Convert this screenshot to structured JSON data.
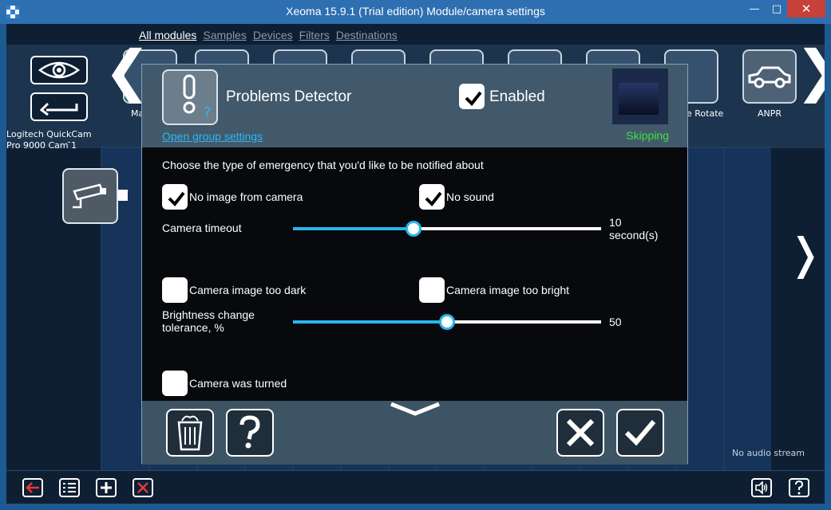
{
  "window": {
    "title": "Xeoma 15.9.1 (Trial edition) Module/camera settings",
    "min_glyph": "—",
    "max_glyph": "□",
    "close_glyph": "✕"
  },
  "nav": {
    "tabs": [
      "All modules",
      "Samples",
      "Devices",
      "Filters",
      "Destinations"
    ]
  },
  "modules_strip": {
    "left_arrow": "❮",
    "right_arrow": "❯",
    "partial_label": "Ma",
    "rotate_label": "e Rotate",
    "anpr_label": "ANPR"
  },
  "camera": {
    "name": "Logitech QuickCam Pro 9000 Cam ̄1"
  },
  "canvas": {
    "right_chevron": "❭",
    "no_audio": "No audio stream"
  },
  "dialog": {
    "module_title": "Problems Detector",
    "group_link": "Open group settings",
    "enabled_label": "Enabled",
    "enabled_checked": true,
    "status": "Skipping",
    "instruction": "Choose the type of emergency that you'd like to be notified about",
    "options": {
      "no_image": {
        "label": "No image from camera",
        "checked": true
      },
      "no_sound": {
        "label": "No sound",
        "checked": true
      },
      "too_dark": {
        "label": "Camera image too dark",
        "checked": false
      },
      "too_bright": {
        "label": "Camera image too bright",
        "checked": false
      },
      "turned": {
        "label": "Camera was turned",
        "checked": false
      }
    },
    "camera_timeout": {
      "label": "Camera timeout",
      "value": "10",
      "unit": "second(s)",
      "fraction": 0.39
    },
    "brightness": {
      "label": "Brightness change tolerance, %",
      "value": "50",
      "fraction": 0.5
    }
  },
  "colors": {
    "accent": "#28b6ea",
    "status_green": "#3ee03e",
    "link": "#2cb8f0",
    "delete_red": "#e53935"
  }
}
